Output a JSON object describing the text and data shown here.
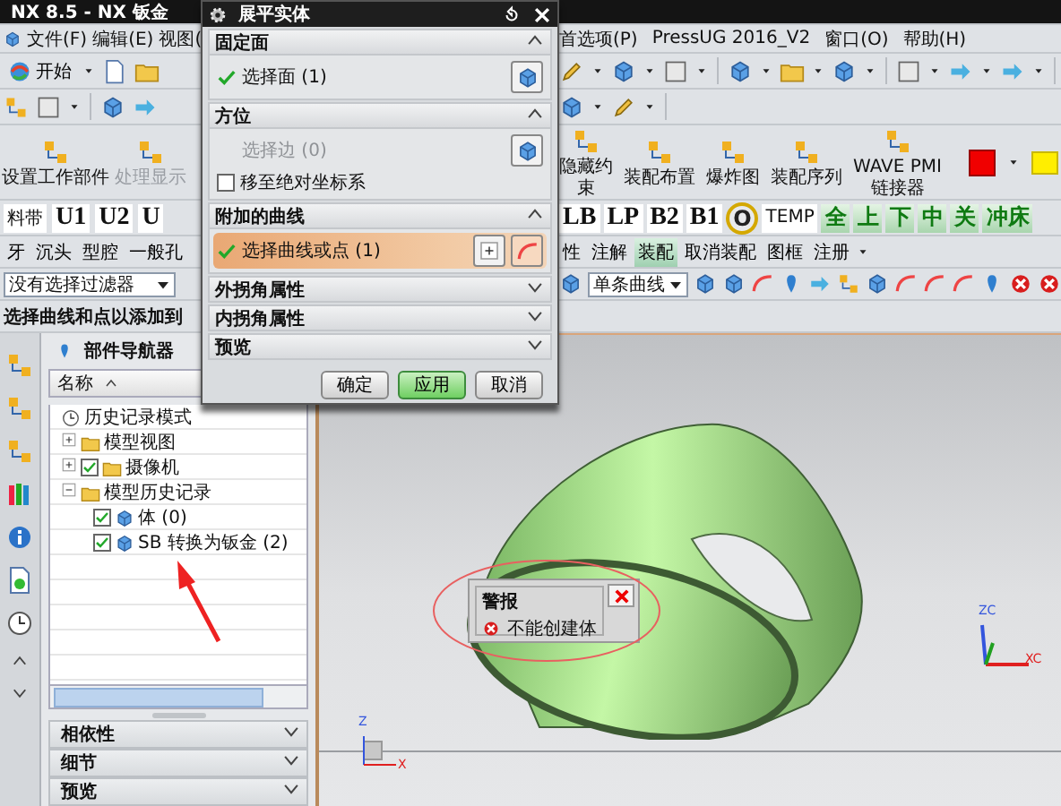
{
  "window": {
    "title": "NX 8.5 - NX 钣金"
  },
  "menu_bar": {
    "left": [
      {
        "label": "文件(F)"
      },
      {
        "label": "编辑(E)"
      },
      {
        "label": "视图("
      }
    ],
    "right": [
      {
        "label": "首选项(P)"
      },
      {
        "label": "PressUG 2016_V2"
      },
      {
        "label": "窗口(O)"
      },
      {
        "label": "帮助(H)"
      }
    ]
  },
  "start_button": {
    "label": "开始"
  },
  "big_toolbar": {
    "left": [
      {
        "lines": [
          "设置工作部件"
        ],
        "enabled": true
      },
      {
        "lines": [
          "处理显示"
        ],
        "enabled": false
      }
    ],
    "right": [
      {
        "lines": [
          "隐藏约",
          "束"
        ],
        "enabled": true
      },
      {
        "lines": [
          "装配布置"
        ],
        "enabled": true
      },
      {
        "lines": [
          "爆炸图"
        ],
        "enabled": true
      },
      {
        "lines": [
          "装配序列"
        ],
        "enabled": true
      },
      {
        "lines": [
          "WAVE PMI",
          "链接器"
        ],
        "enabled": true
      }
    ]
  },
  "letter_toolbar": {
    "left": [
      {
        "kind": "tag",
        "label": "料带"
      },
      {
        "kind": "big",
        "label": "U1"
      },
      {
        "kind": "big",
        "label": "U2"
      },
      {
        "kind": "big",
        "label": "U"
      }
    ],
    "right": [
      {
        "kind": "big",
        "label": "LB"
      },
      {
        "kind": "big",
        "label": "LP"
      },
      {
        "kind": "big",
        "label": "B2"
      },
      {
        "kind": "big",
        "label": "B1"
      },
      {
        "kind": "ring",
        "label": "O"
      },
      {
        "kind": "tag",
        "label": "TEMP"
      },
      {
        "kind": "green",
        "label": "全"
      },
      {
        "kind": "green",
        "label": "上"
      },
      {
        "kind": "green",
        "label": "下"
      },
      {
        "kind": "green",
        "label": "中"
      },
      {
        "kind": "green",
        "label": "关"
      },
      {
        "kind": "green",
        "label": "冲床"
      }
    ]
  },
  "text_toolbar": {
    "left": [
      {
        "label": "牙",
        "pressed": false
      },
      {
        "label": "沉头",
        "pressed": false
      },
      {
        "label": "型腔",
        "pressed": false
      },
      {
        "label": "一般孔",
        "pressed": false
      }
    ],
    "right": [
      {
        "label": "性",
        "pressed": false
      },
      {
        "label": "注解",
        "pressed": false
      },
      {
        "label": "装配",
        "pressed": true
      },
      {
        "label": "取消装配",
        "pressed": false
      },
      {
        "label": "图框",
        "pressed": false
      },
      {
        "label": "注册",
        "pressed": false
      }
    ]
  },
  "selection_filter": {
    "value": "没有选择过滤器"
  },
  "curve_rule": {
    "value": "单条曲线"
  },
  "prompt": "选择曲线和点以添加到",
  "part_navigator": {
    "title": "部件导航器",
    "column": "名称",
    "tree": [
      {
        "label": "历史记录模式"
      },
      {
        "label": "模型视图",
        "expanded": false
      },
      {
        "label": "摄像机",
        "expanded": false,
        "checked": true
      },
      {
        "label": "模型历史记录",
        "expanded": true,
        "children": [
          {
            "label": "体 (0)",
            "checked": true
          },
          {
            "label": "SB 转换为钣金 (2)",
            "checked": true
          }
        ]
      }
    ],
    "panels": [
      {
        "label": "相依性",
        "expanded": false
      },
      {
        "label": "细节",
        "expanded": false
      },
      {
        "label": "预览",
        "expanded": false
      }
    ]
  },
  "dialog": {
    "title": "展平实体",
    "sections": [
      {
        "title": "固定面",
        "expanded": true,
        "rows": [
          {
            "kind": "selector",
            "label": "选择面 (1)",
            "done": true,
            "enabled": true,
            "selected": false
          }
        ]
      },
      {
        "title": "方位",
        "expanded": true,
        "rows": [
          {
            "kind": "selector",
            "label": "选择边 (0)",
            "done": false,
            "enabled": false,
            "selected": false
          },
          {
            "kind": "checkbox",
            "label": "移至绝对坐标系",
            "checked": false
          }
        ]
      },
      {
        "title": "附加的曲线",
        "expanded": true,
        "rows": [
          {
            "kind": "selector",
            "label": "选择曲线或点 (1)",
            "done": true,
            "enabled": true,
            "selected": true
          }
        ]
      },
      {
        "title": "外拐角属性",
        "expanded": false
      },
      {
        "title": "内拐角属性",
        "expanded": false
      },
      {
        "title": "预览",
        "expanded": false
      }
    ],
    "buttons": [
      {
        "label": "确定",
        "default": false
      },
      {
        "label": "应用",
        "default": true
      },
      {
        "label": "取消",
        "default": false
      }
    ]
  },
  "alert": {
    "title": "警报",
    "message": "不能创建体"
  },
  "view_triad": {
    "z": "ZC",
    "x": "XC"
  },
  "origin_triad": {
    "z": "Z",
    "x": "X"
  }
}
